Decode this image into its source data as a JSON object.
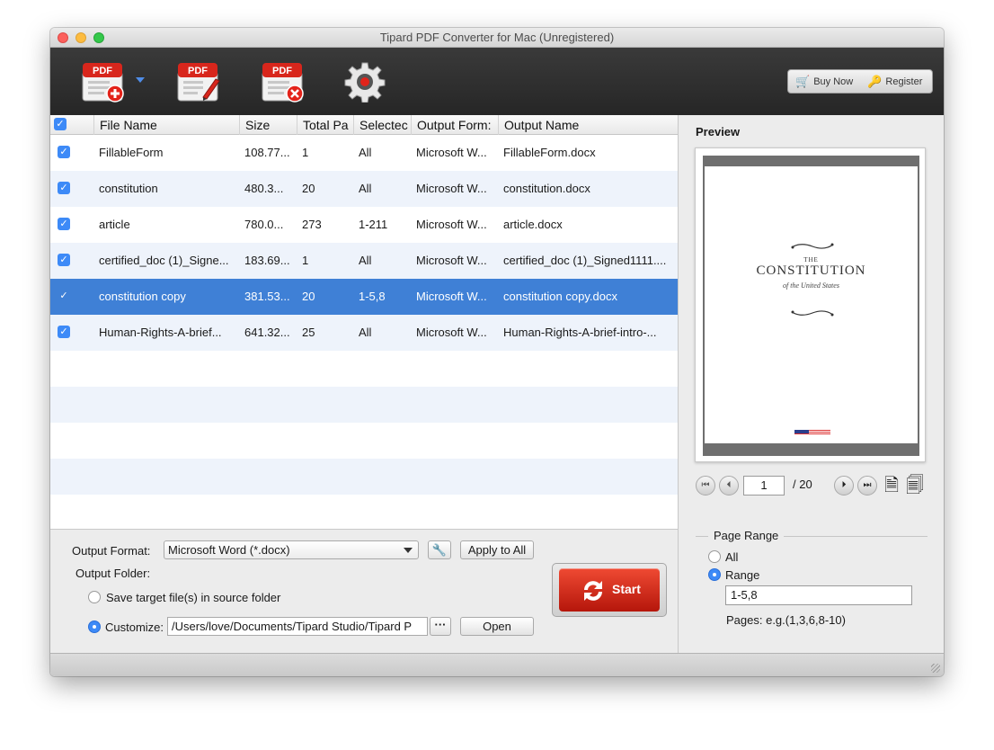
{
  "window": {
    "title": "Tipard PDF Converter for Mac (Unregistered)"
  },
  "toolbar": {
    "pdf_badge": "PDF",
    "buy_now": "Buy Now",
    "register": "Register"
  },
  "table": {
    "headers": [
      "File Name",
      "Size",
      "Total Pa",
      "Selectec",
      "Output Form:",
      "Output Name"
    ],
    "rows": [
      {
        "name": "FillableForm",
        "size": "108.77...",
        "total": "1",
        "selected": "All",
        "format": "Microsoft W...",
        "output": "FillableForm.docx",
        "checked": true
      },
      {
        "name": "constitution",
        "size": "480.3...",
        "total": "20",
        "selected": "All",
        "format": "Microsoft W...",
        "output": "constitution.docx",
        "checked": true
      },
      {
        "name": "article",
        "size": "780.0...",
        "total": "273",
        "selected": "1-211",
        "format": "Microsoft W...",
        "output": "article.docx",
        "checked": true
      },
      {
        "name": "certified_doc (1)_Signe...",
        "size": "183.69...",
        "total": "1",
        "selected": "All",
        "format": "Microsoft W...",
        "output": "certified_doc (1)_Signed1111....",
        "checked": true
      },
      {
        "name": "constitution copy",
        "size": "381.53...",
        "total": "20",
        "selected": "1-5,8",
        "format": "Microsoft W...",
        "output": "constitution copy.docx",
        "checked": true,
        "selected_row": true
      },
      {
        "name": "Human-Rights-A-brief...",
        "size": "641.32...",
        "total": "25",
        "selected": "All",
        "format": "Microsoft W...",
        "output": "Human-Rights-A-brief-intro-...",
        "checked": true
      }
    ]
  },
  "output": {
    "format_label": "Output Format:",
    "format_value": "Microsoft Word (*.docx)",
    "apply_all": "Apply to All",
    "folder_label": "Output Folder:",
    "save_source": "Save target file(s) in source folder",
    "customize_label": "Customize:",
    "path": "/Users/love/Documents/Tipard Studio/Tipard P",
    "browse": "···",
    "open": "Open",
    "start": "Start"
  },
  "preview": {
    "label": "Preview",
    "doc_the": "THE",
    "doc_title": "CONSTITUTION",
    "doc_sub": "of the United States",
    "current_page": "1",
    "total_pages": "/ 20"
  },
  "page_range": {
    "label": "Page Range",
    "all": "All",
    "range": "Range",
    "value": "1-5,8",
    "hint": "Pages: e.g.(1,3,6,8-10)"
  },
  "colors": {
    "accent": "#3d8af7",
    "selection": "#3f80d6",
    "start": "#d82a18"
  }
}
